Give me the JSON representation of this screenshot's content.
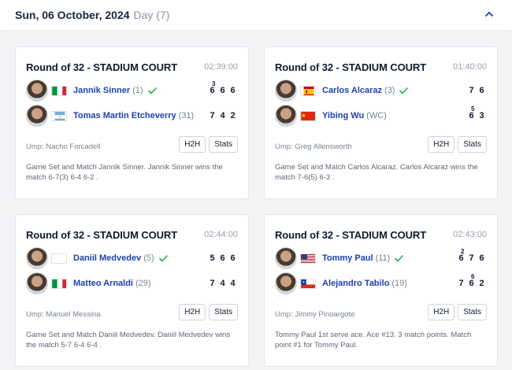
{
  "header": {
    "date": "Sun, 06 October, 2024",
    "day": "Day (7)",
    "toggle_icon": "chevron-up-icon",
    "accent": "#1f3fb0"
  },
  "matches": [
    {
      "round": "Round of 32 - STADIUM COURT",
      "time": "02:39:00",
      "players": [
        {
          "name": "Jannik Sinner",
          "seed": "(1)",
          "flag": "italy",
          "winner": true,
          "scores": [
            {
              "s": "6",
              "tb": "3"
            },
            {
              "s": "6",
              "tb": ""
            },
            {
              "s": "6",
              "tb": ""
            }
          ]
        },
        {
          "name": "Tomas Martin Etcheverry",
          "seed": "(31)",
          "flag": "argentina",
          "winner": false,
          "scores": [
            {
              "s": "7",
              "tb": ""
            },
            {
              "s": "4",
              "tb": ""
            },
            {
              "s": "2",
              "tb": ""
            }
          ]
        }
      ],
      "umpire": "Ump: Nacho Forcadell",
      "h2h": "H2H",
      "stats": "Stats",
      "description": "Game Set and Match Jannik Sinner. Jannik Sinner wins the match 6-7(3) 6-4 6-2 ."
    },
    {
      "round": "Round of 32 - STADIUM COURT",
      "time": "01:40:00",
      "players": [
        {
          "name": "Carlos Alcaraz",
          "seed": "(3)",
          "flag": "spain",
          "winner": true,
          "scores": [
            {
              "s": "7",
              "tb": ""
            },
            {
              "s": "6",
              "tb": ""
            }
          ]
        },
        {
          "name": "Yibing Wu",
          "seed": "(WC)",
          "flag": "china",
          "winner": false,
          "scores": [
            {
              "s": "6",
              "tb": "5"
            },
            {
              "s": "3",
              "tb": ""
            }
          ]
        }
      ],
      "umpire": "Ump: Greg Allensworth",
      "h2h": "H2H",
      "stats": "Stats",
      "description": "Game Set and Match Carlos Alcaraz. Carlos Alcaraz wins the match 7-6(5) 6-3 ."
    },
    {
      "round": "Round of 32 - STADIUM COURT",
      "time": "02:44:00",
      "players": [
        {
          "name": "Daniil Medvedev",
          "seed": "(5)",
          "flag": "neutral",
          "winner": true,
          "scores": [
            {
              "s": "5",
              "tb": ""
            },
            {
              "s": "6",
              "tb": ""
            },
            {
              "s": "6",
              "tb": ""
            }
          ]
        },
        {
          "name": "Matteo Arnaldi",
          "seed": "(29)",
          "flag": "italy",
          "winner": false,
          "scores": [
            {
              "s": "7",
              "tb": ""
            },
            {
              "s": "4",
              "tb": ""
            },
            {
              "s": "4",
              "tb": ""
            }
          ]
        }
      ],
      "umpire": "Ump: Manuel Messina",
      "h2h": "H2H",
      "stats": "Stats",
      "description": "Game Set and Match Daniil Medvedev. Daniil Medvedev wins the match 5-7 6-4 6-4 ."
    },
    {
      "round": "Round of 32 - STADIUM COURT",
      "time": "02:43:00",
      "players": [
        {
          "name": "Tommy Paul",
          "seed": "(11)",
          "flag": "usa",
          "winner": true,
          "scores": [
            {
              "s": "6",
              "tb": "2"
            },
            {
              "s": "7",
              "tb": ""
            },
            {
              "s": "6",
              "tb": ""
            }
          ]
        },
        {
          "name": "Alejandro Tabilo",
          "seed": "(19)",
          "flag": "chile",
          "winner": false,
          "scores": [
            {
              "s": "7",
              "tb": ""
            },
            {
              "s": "6",
              "tb": "6"
            },
            {
              "s": "2",
              "tb": ""
            }
          ]
        }
      ],
      "umpire": "Ump: Jimmy Pinoargote",
      "h2h": "H2H",
      "stats": "Stats",
      "description": "Tommy Paul 1st serve ace. Ace #13. 3 match points. Match point #1 for Tommy Paul."
    }
  ]
}
